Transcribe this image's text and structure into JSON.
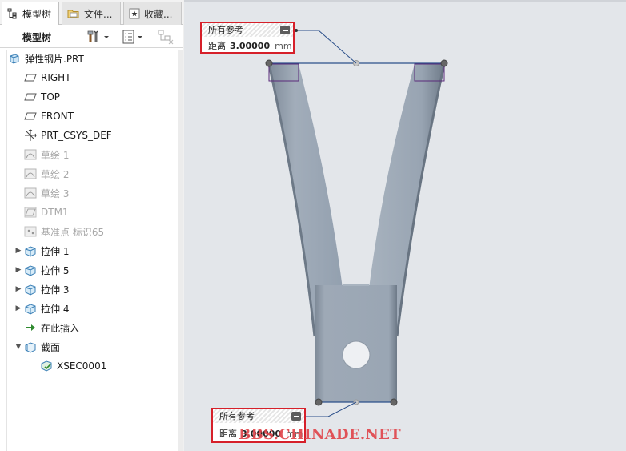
{
  "tabs": [
    {
      "label": "模型树"
    },
    {
      "label": "文件..."
    },
    {
      "label": "收藏..."
    }
  ],
  "toolbar": {
    "title": "模型树"
  },
  "tree": [
    {
      "label": "弹性钢片.PRT",
      "icon": "part-icon",
      "expander": "",
      "dim": false
    },
    {
      "label": "RIGHT",
      "icon": "datum-plane-icon",
      "expander": "",
      "dim": false
    },
    {
      "label": "TOP",
      "icon": "datum-plane-icon",
      "expander": "",
      "dim": false
    },
    {
      "label": "FRONT",
      "icon": "datum-plane-icon",
      "expander": "",
      "dim": false
    },
    {
      "label": "PRT_CSYS_DEF",
      "icon": "csys-icon",
      "expander": "",
      "dim": false
    },
    {
      "label": "草绘 1",
      "icon": "sketch-icon",
      "expander": "",
      "dim": true
    },
    {
      "label": "草绘 2",
      "icon": "sketch-icon",
      "expander": "",
      "dim": true
    },
    {
      "label": "草绘 3",
      "icon": "sketch-icon",
      "expander": "",
      "dim": true
    },
    {
      "label": "DTM1",
      "icon": "datum-plane-icon",
      "expander": "",
      "dim": true
    },
    {
      "label": "基准点 标识65",
      "icon": "datum-point-icon",
      "expander": "",
      "dim": true
    },
    {
      "label": "拉伸 1",
      "icon": "extrude-icon",
      "expander": "collapsed",
      "dim": false
    },
    {
      "label": "拉伸 5",
      "icon": "extrude-icon",
      "expander": "collapsed",
      "dim": false
    },
    {
      "label": "拉伸 3",
      "icon": "extrude-icon",
      "expander": "collapsed",
      "dim": false
    },
    {
      "label": "拉伸 4",
      "icon": "extrude-icon",
      "expander": "collapsed",
      "dim": false
    },
    {
      "label": "在此插入",
      "icon": "insert-arrow-icon",
      "expander": "",
      "dim": false
    },
    {
      "label": "截面",
      "icon": "section-icon",
      "expander": "expanded",
      "dim": false
    },
    {
      "label": "XSEC0001",
      "icon": "xsec-icon",
      "expander": "",
      "dim": false,
      "child": true
    }
  ],
  "dimension_top": {
    "header": "所有参考",
    "label": "距离",
    "value": "3.00000",
    "unit": "mm"
  },
  "dimension_bottom": {
    "header": "所有参考",
    "label": "距离",
    "value": "3.00000",
    "unit": "mm"
  },
  "watermark": "BBS.CHINADE.NET",
  "colors": {
    "highlight_border": "#d6202a",
    "part_fill": "#9aa6b4",
    "reference_line": "#2b4f8a",
    "viewport_bg": "#e3e6ea"
  }
}
